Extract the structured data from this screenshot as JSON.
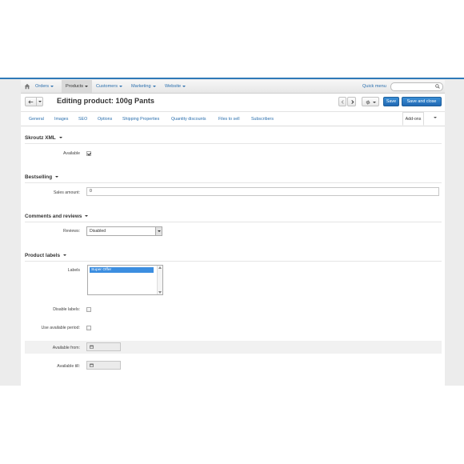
{
  "navbar": {
    "items": [
      {
        "label": "Orders"
      },
      {
        "label": "Products"
      },
      {
        "label": "Customers"
      },
      {
        "label": "Marketing"
      },
      {
        "label": "Website"
      }
    ],
    "active_item": "Products",
    "quick_menu": "Quick menu",
    "search_placeholder": ""
  },
  "titlebar": {
    "title": "Editing product: 100g Pants",
    "save_label": "Save",
    "save_close_label": "Save and close"
  },
  "tabs": {
    "items": [
      {
        "label": "General"
      },
      {
        "label": "Images"
      },
      {
        "label": "SEO"
      },
      {
        "label": "Options"
      },
      {
        "label": "Shipping Properties"
      },
      {
        "label": "Quantity discounts"
      },
      {
        "label": "Files to sell"
      },
      {
        "label": "Subscribers"
      }
    ],
    "active": "Add-ons"
  },
  "sections": {
    "skroutz": {
      "title": "Skroutz XML",
      "available_label": "Available",
      "available_checked": true
    },
    "bestselling": {
      "title": "Bestselling",
      "sales_label": "Sales amount:",
      "sales_value": "0"
    },
    "comments": {
      "title": "Comments and reviews",
      "reviews_label": "Reviews:",
      "reviews_value": "Disabled"
    },
    "labels": {
      "title": "Product labels",
      "labels_label": "Labels",
      "selected_option": "Super Offer",
      "disable_label": "Disable labels:",
      "use_period_label": "Use available period:",
      "from_label": "Available from:",
      "till_label": "Available till:"
    }
  },
  "colors": {
    "primary": "#2168b3",
    "link": "#2a6fae",
    "selection": "#3c8ee0"
  }
}
